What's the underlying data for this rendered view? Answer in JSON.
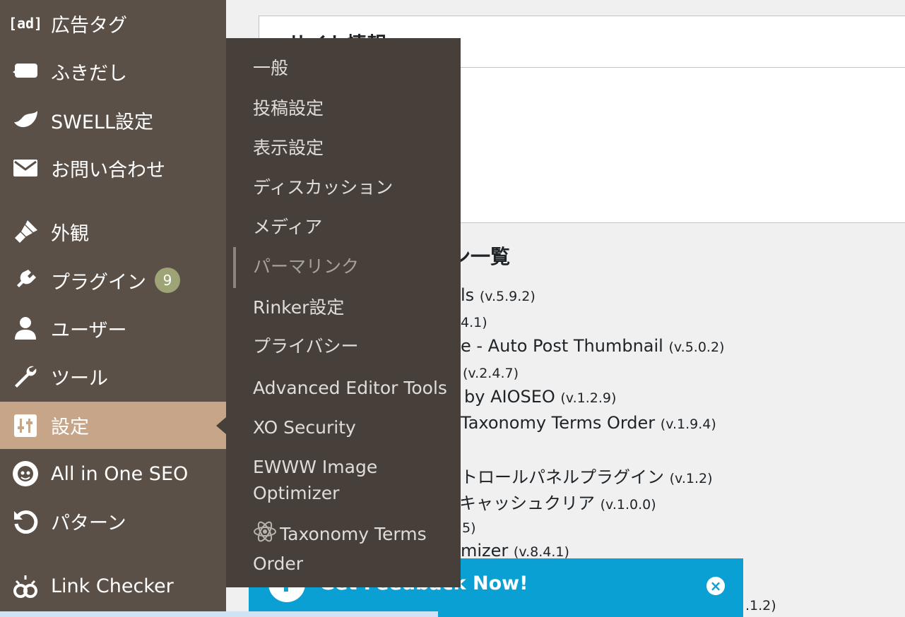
{
  "sidebar": {
    "items": [
      {
        "label": "広告タグ",
        "icon": "ad-tag-icon",
        "icon_text": "[ad]"
      },
      {
        "label": "ふきだし",
        "icon": "speech-bubble-icon"
      },
      {
        "label": "SWELL設定",
        "icon": "swell-logo-icon"
      },
      {
        "label": "お問い合わせ",
        "icon": "mail-icon"
      },
      {
        "label": "外観",
        "icon": "paintbrush-icon"
      },
      {
        "label": "プラグイン",
        "icon": "plugin-icon",
        "badge": "9"
      },
      {
        "label": "ユーザー",
        "icon": "user-icon"
      },
      {
        "label": "ツール",
        "icon": "wrench-icon"
      },
      {
        "label": "設定",
        "icon": "settings-sliders-icon",
        "current": true
      },
      {
        "label": "All in One SEO",
        "icon": "aioseo-icon"
      },
      {
        "label": "パターン",
        "icon": "undo-icon"
      },
      {
        "label": "Link Checker",
        "icon": "link-checker-icon"
      }
    ]
  },
  "submenu": {
    "items": [
      {
        "label": "一般"
      },
      {
        "label": "投稿設定"
      },
      {
        "label": "表示設定"
      },
      {
        "label": "ディスカッション"
      },
      {
        "label": "メディア"
      },
      {
        "label": "パーマリンク",
        "current": true
      },
      {
        "label": "Rinker設定"
      },
      {
        "label": "プライバシー"
      },
      {
        "label": "Advanced Editor Tools"
      },
      {
        "label": "XO Security"
      },
      {
        "label": "EWWW Image Optimizer"
      },
      {
        "label": "Taxonomy Terms Order",
        "icon": "atom-icon"
      }
    ]
  },
  "main": {
    "panel_title": "サイト情報",
    "section_title": "ン一覧",
    "plugins": [
      {
        "name": "ls",
        "version": "(v.5.9.2)"
      },
      {
        "name": "",
        "version": "4.1)"
      },
      {
        "name": "e - Auto Post Thumbnail",
        "version": "(v.5.0.2)"
      },
      {
        "name": "",
        "version": "(v.2.4.7)"
      },
      {
        "name": "by AIOSEO",
        "version": "(v.1.2.9)"
      },
      {
        "name": "Taxonomy Terms Order",
        "version": "(v.1.9.4)"
      },
      {
        "name": "トロールパネルプラグイン",
        "version": "(v.1.2)"
      },
      {
        "name": "キャッシュクリア",
        "version": "(v.1.0.0)"
      },
      {
        "name": "",
        "version": "5)"
      },
      {
        "name": "mizer",
        "version": "(v.8.4.1)"
      },
      {
        "name": "",
        "version": ".1.2)"
      }
    ]
  },
  "feedback": {
    "text": "Get Feedback Now!",
    "icon": "question-icon",
    "close_icon": "close-circle-icon",
    "color": "#0ba0d3"
  },
  "colors": {
    "sidebar_bg": "#5b5048",
    "sidebar_current": "#c7a589",
    "submenu_bg": "#463f3a",
    "badge_bg": "#9ea476"
  }
}
